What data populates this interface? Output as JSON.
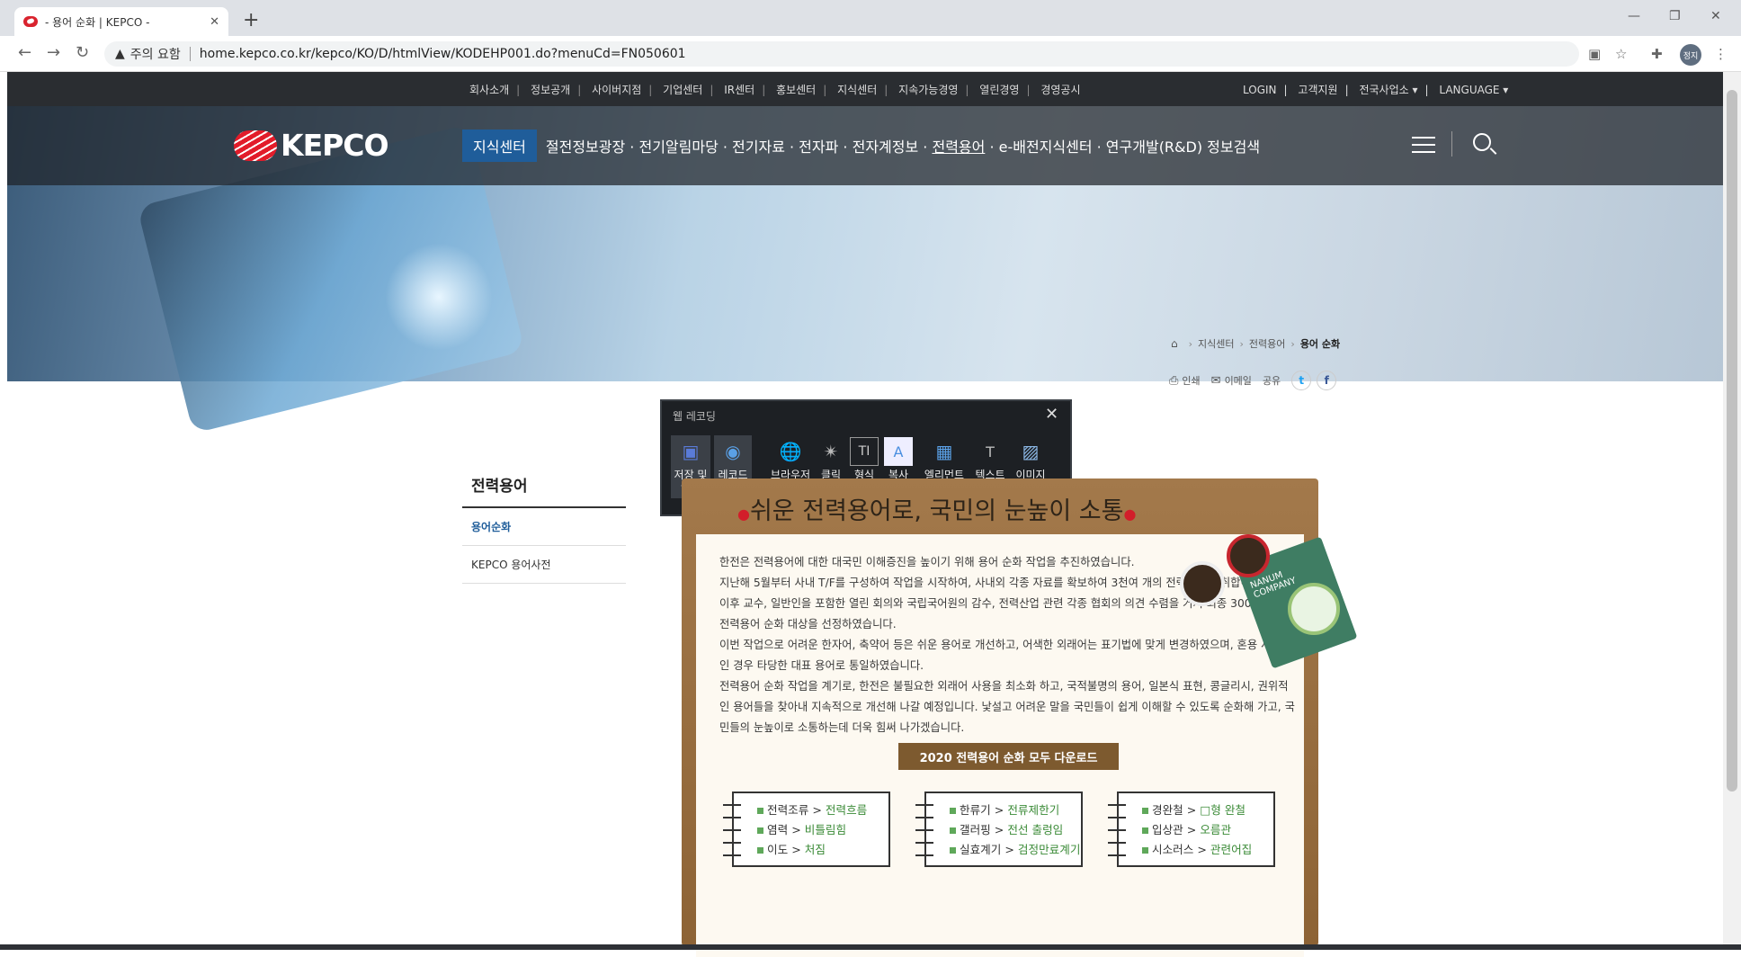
{
  "browser": {
    "tab_title": "- 용어 순화 | KEPCO -",
    "tab_close": "✕",
    "new_tab": "+",
    "url_warning": "주의 요함",
    "url": "home.kepco.co.kr/kepco/KO/D/htmlView/KODEHP001.do?menuCd=FN050601",
    "profile_label": "정지"
  },
  "site": {
    "top_menu": [
      "회사소개",
      "정보공개",
      "사이버지점",
      "기업센터",
      "IR센터",
      "홍보센터",
      "지식센터",
      "지속가능경영",
      "열린경영",
      "경영공시"
    ],
    "top_right": [
      "LOGIN",
      "고객지원",
      "전국사업소 ▾",
      "LANGUAGE ▾"
    ],
    "logo_text": "KEPCO",
    "gnb_badge": "지식센터",
    "gnb_menu_before": "절전정보광장 · 전기알림마당 · 전기자료 · 전자파 · 전자계정보 · ",
    "gnb_menu_current": "전력용어",
    "gnb_menu_after": " · e-배전지식센터 · 연구개발(R&D) 정보검색"
  },
  "breadcrumb": {
    "items": [
      "지식센터",
      "전력용어"
    ],
    "current": "용어 순화"
  },
  "share": {
    "print": "인쇄",
    "email": "이메일",
    "share": "공유",
    "twitter": "t",
    "facebook": "f"
  },
  "lnb": {
    "title": "전력용어",
    "items": [
      "용어순화",
      "KEPCO 용어사전"
    ]
  },
  "recorder": {
    "title": "웹 레코딩",
    "close": "✕",
    "buttons": [
      {
        "label": "저장 및\n종료",
        "icon": "save-stop-icon"
      },
      {
        "label": "레코드",
        "icon": "record-icon"
      },
      {
        "label": "브라우저\n열기",
        "icon": "browser-icon"
      },
      {
        "label": "클릭",
        "icon": "click-icon"
      },
      {
        "label": "형식",
        "icon": "format-icon"
      },
      {
        "label": "복사",
        "icon": "copy-icon"
      },
      {
        "label": "엘리먼트",
        "icon": "element-icon"
      },
      {
        "label": "텍스트",
        "icon": "text-icon"
      },
      {
        "label": "이미지",
        "icon": "image-icon"
      }
    ]
  },
  "board": {
    "headline": "쉬운 전력용어로, 국민의 눈높이 소통",
    "book_label": "NANUM COMPANY",
    "paragraphs": [
      "한전은 전력용어에 대한 대국민 이해증진을 높이기 위해 용어 순화 작업을 추진하였습니다.",
      "지난해 5월부터 사내 T/F를 구성하여 작업을 시작하여, 사내외 각종 자료를 확보하여 3천여 개의 전력용어를 취합하였습니다. 이후 교수, 일반인을 포함한 열린 회의와 국립국어원의 감수, 전력산업 관련 각종 협회의 의견 수렴을 거쳐 최종 300여 개의 전력용어 순화 대상을 선정하였습니다.",
      "이번 작업으로 어려운 한자어, 축약어 등은 쉬운 용어로 개선하고, 어색한 외래어는 표기법에 맞게 변경하였으며, 혼용 사용 중인 경우 타당한 대표 용어로 통일하였습니다.",
      "전력용어 순화 작업을 계기로, 한전은 불필요한 외래어 사용을 최소화 하고, 국적불명의 용어, 일본식 표현, 콩글리시, 권위적인 용어들을 찾아내 지속적으로 개선해 나갈 예정입니다. 낯설고 어려운 말을 국민들이 쉽게 이해할 수 있도록 순화해 가고, 국민들의 눈높이로 소통하는데 더욱 힘써 나가겠습니다."
    ],
    "download_label": "2020 전력용어 순화 모두 다운로드",
    "notes": [
      [
        [
          "전력조류",
          "전력흐름"
        ],
        [
          "염력",
          "비틀림힘"
        ],
        [
          "이도",
          "처짐"
        ]
      ],
      [
        [
          "한류기",
          "전류제한기"
        ],
        [
          "갤러핑",
          "전선 출렁임"
        ],
        [
          "실효계기",
          "검정만료계기"
        ]
      ],
      [
        [
          "경완철",
          "□형 완철"
        ],
        [
          "입상관",
          "오름관"
        ],
        [
          "시소러스",
          "관련어집"
        ]
      ]
    ]
  }
}
